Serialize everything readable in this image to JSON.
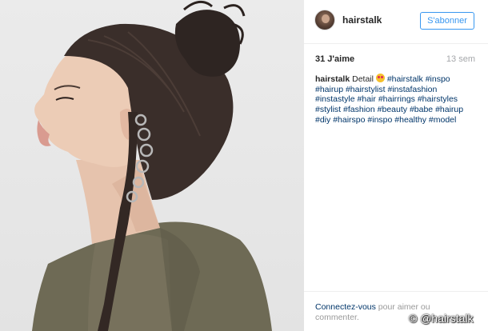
{
  "post": {
    "username": "hairstalk",
    "follow_label": "S'abonner",
    "likes": "31 J'aime",
    "time": "13 sem",
    "caption_author": "hairstalk",
    "caption_text": "Detail",
    "hashtags": [
      "#hairstalk",
      "#inspo",
      "#hairup",
      "#hairstylist",
      "#instafashion",
      "#instastyle",
      "#hair",
      "#hairrings",
      "#hairstyles",
      "#stylist",
      "#fashion",
      "#beauty",
      "#babe",
      "#hairup",
      "#diy",
      "#hairspo",
      "#inspo",
      "#healthy",
      "#model"
    ],
    "login_link": "Connectez-vous",
    "comment_prompt": "pour aimer ou commenter.",
    "more_options": "..."
  },
  "watermark": "© @hairstalk",
  "colors": {
    "accent": "#3897f0",
    "hashtag": "#003569",
    "muted": "#a5a7aa"
  }
}
